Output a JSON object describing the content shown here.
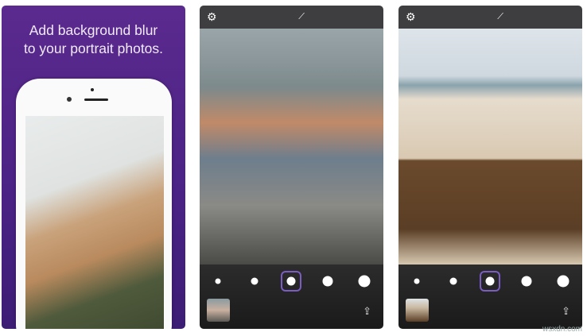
{
  "promo": {
    "headline_line1": "Add background blur",
    "headline_line2": "to your portrait photos."
  },
  "screens": [
    {
      "settings_icon": "gear-icon",
      "edit_icon": "brush-icon",
      "share_icon": "share-icon",
      "selected_blur_level": 3,
      "blur_levels": 5
    },
    {
      "settings_icon": "gear-icon",
      "edit_icon": "brush-icon",
      "share_icon": "share-icon",
      "selected_blur_level": 3,
      "blur_levels": 5
    }
  ],
  "icons": {
    "gear": "⚙",
    "brush": "🖌",
    "share": "⇪"
  },
  "accent_color": "#7a5cc2",
  "watermark": "wsxdn.com"
}
